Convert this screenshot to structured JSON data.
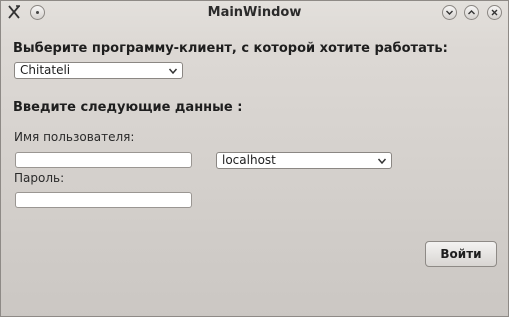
{
  "window": {
    "title": "MainWindow"
  },
  "client_section": {
    "prompt": "Выберите программу-клиент, с которой хотите работать:",
    "selected_client": "Chitateli"
  },
  "data_section": {
    "heading": "Введите следующие данные :",
    "username_label": "Имя пользователя:",
    "username_value": "",
    "host_selected": "localhost",
    "password_label": "Пароль:",
    "password_value": ""
  },
  "actions": {
    "login_label": "Войти"
  }
}
